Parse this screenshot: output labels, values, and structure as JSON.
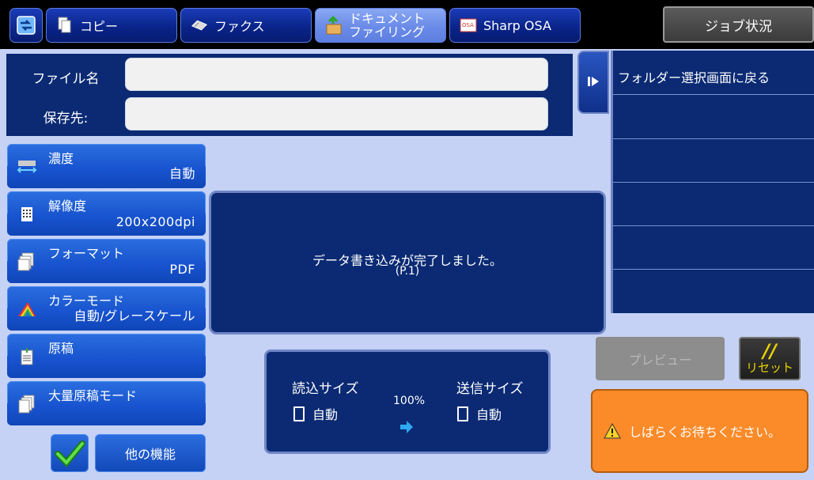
{
  "tabs": [
    {
      "label": "コピー",
      "icon": "copy-icon"
    },
    {
      "label": "ファクス",
      "icon": "fax-icon"
    },
    {
      "label_line1": "ドキュメント",
      "label_line2": "ファイリング",
      "icon": "document-filing-icon",
      "active": true
    },
    {
      "label": "Sharp OSA",
      "icon": "sharp-osa-icon"
    }
  ],
  "job_status_label": "ジョブ状況",
  "file": {
    "name_label": "ファイル名",
    "name_value": "",
    "dest_label": "保存先:",
    "dest_value": ""
  },
  "settings": [
    {
      "title": "濃度",
      "value": "自動",
      "icon": "density-icon"
    },
    {
      "title": "解像度",
      "value": "200x200dpi",
      "icon": "resolution-icon"
    },
    {
      "title": "フォーマット",
      "value": "PDF",
      "icon": "format-icon"
    },
    {
      "title": "カラーモード",
      "value": "自動/グレースケール",
      "icon": "color-mode-icon"
    },
    {
      "title": "原稿",
      "value": "",
      "icon": "original-icon"
    },
    {
      "title": "大量原稿モード",
      "value": "",
      "icon": "job-build-icon"
    }
  ],
  "message": {
    "line1": "データ書き込みが完了しました。",
    "line2": "(P.1)"
  },
  "size": {
    "scan_label": "読込サイズ",
    "scan_value": "自動",
    "ratio": "100%",
    "send_label": "送信サイズ",
    "send_value": "自動"
  },
  "right_panel": {
    "back_label": "フォルダー選択画面に戻る",
    "rows": [
      "",
      "",
      "",
      "",
      ""
    ]
  },
  "preview_label": "プレビュー",
  "reset_label": "リセット",
  "wait_message": "しばらくお待ちください。",
  "other_functions_label": "他の機能",
  "colors": {
    "header_bg": "#000000",
    "panel_dark": "#0b2a73",
    "button_blue": "#1a57cf",
    "background": "#c5d2f5",
    "warning": "#fb8a28"
  }
}
